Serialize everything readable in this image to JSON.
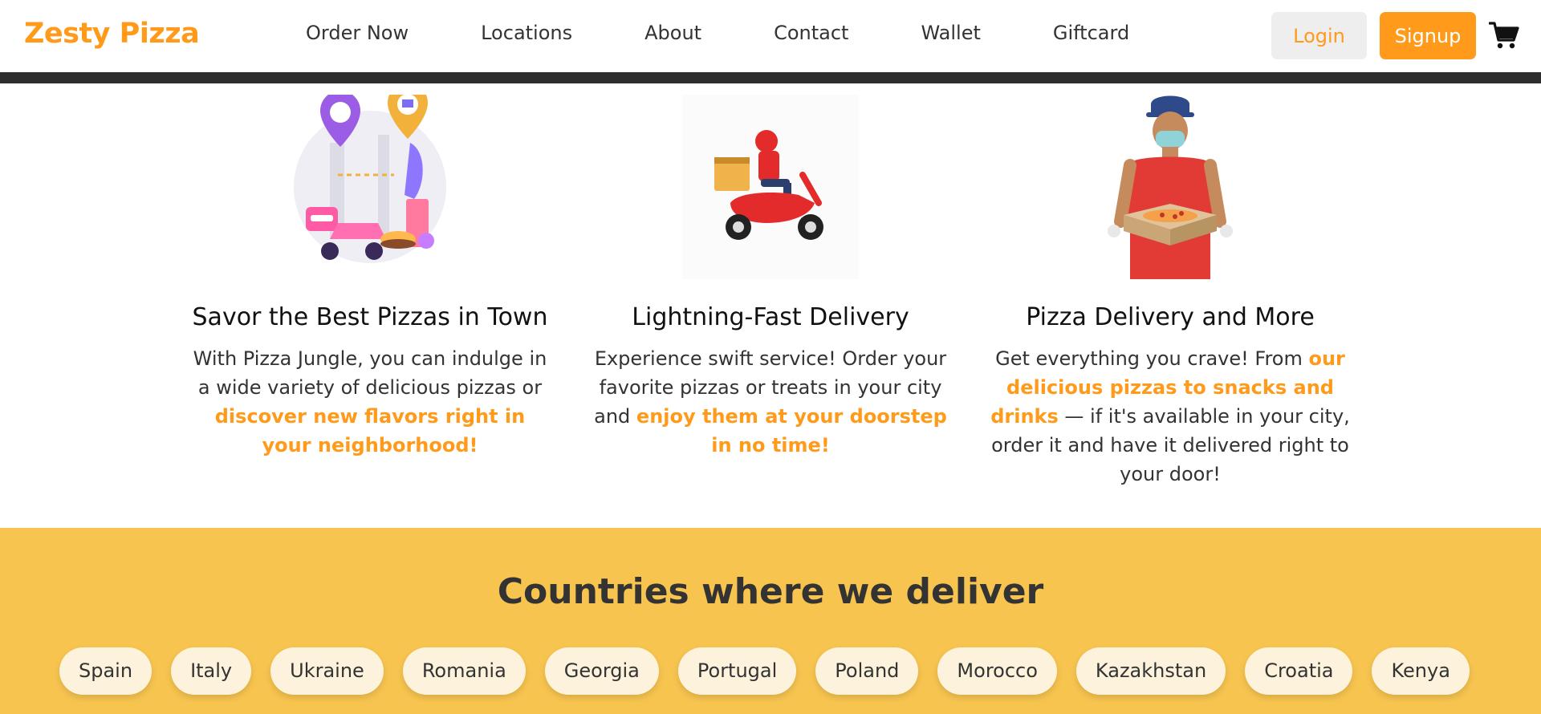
{
  "brand": "Zesty Pizza",
  "nav": {
    "links": [
      "Order Now",
      "Locations",
      "About",
      "Contact",
      "Wallet",
      "Giftcard"
    ],
    "login_label": "Login",
    "signup_label": "Signup"
  },
  "features": [
    {
      "title": "Savor the Best Pizzas in Town",
      "text_before": "With Pizza Jungle, you can indulge in a wide variety of delicious pizzas or ",
      "highlight": "discover new flavors right in your neighborhood!",
      "text_after": ""
    },
    {
      "title": "Lightning-Fast Delivery",
      "text_before": "Experience swift service! Order your favorite pizzas or treats in your city and ",
      "highlight": "enjoy them at your doorstep in no time!",
      "text_after": ""
    },
    {
      "title": "Pizza Delivery and More",
      "text_before": "Get everything you crave! From ",
      "highlight": "our delicious pizzas to snacks and drinks",
      "text_after": " — if it's available in your city, order it and have it delivered right to your door!"
    }
  ],
  "countries": {
    "heading": "Countries where we deliver",
    "list": [
      "Spain",
      "Italy",
      "Ukraine",
      "Romania",
      "Georgia",
      "Portugal",
      "Poland",
      "Morocco",
      "Kazakhstan",
      "Croatia",
      "Kenya"
    ]
  },
  "colors": {
    "accent": "#ff9a1a",
    "band": "#f7c44f",
    "chip": "#fdf3dc"
  }
}
